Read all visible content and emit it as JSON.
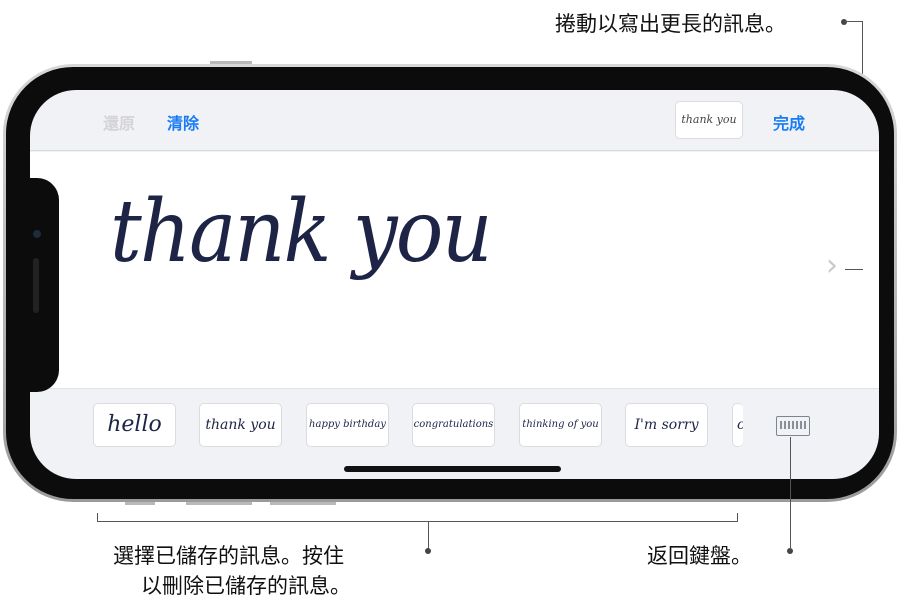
{
  "toolbar": {
    "undo": "還原",
    "clear": "清除",
    "preview": "thank you",
    "done": "完成"
  },
  "canvas": {
    "handwriting": "thank you",
    "next_icon": "chevron-right-icon"
  },
  "saved_messages": [
    "hello",
    "thank you",
    "happy birthday",
    "congratulations",
    "thinking of you",
    "I'm sorry",
    "c"
  ],
  "keyboard_icon": "keyboard-icon",
  "callouts": {
    "scroll": "捲動以寫出更長的訊息。",
    "saved_line1": "選擇已儲存的訊息。按住",
    "saved_line2": "以刪除已儲存的訊息。",
    "keyboard": "返回鍵盤。"
  }
}
